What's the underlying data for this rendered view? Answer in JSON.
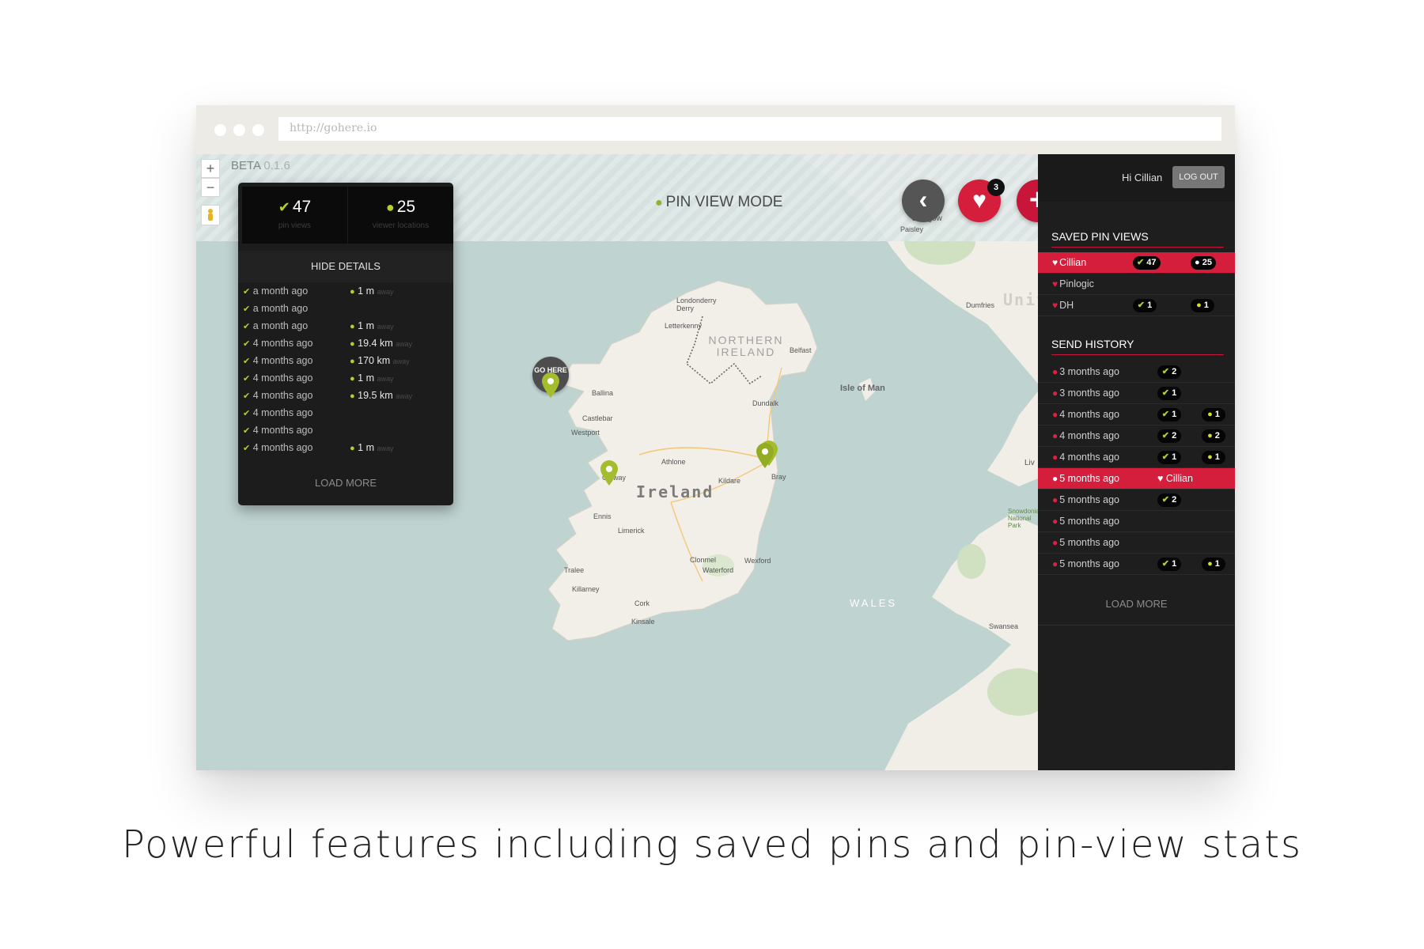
{
  "browser": {
    "url": "http://gohere.io"
  },
  "app": {
    "beta_label": "BETA",
    "beta_version": "0.1.6",
    "mode_label": "PIN VIEW MODE"
  },
  "toolbar": {
    "zoom_in": "+",
    "zoom_out": "−",
    "back_glyph": "‹",
    "fav_glyph": "♥",
    "add_glyph": "+",
    "fav_count": "3"
  },
  "map": {
    "labels": [
      {
        "text": "Ireland"
      },
      {
        "text": "NORTHERN IRELAND"
      },
      {
        "text": "Isle of Man"
      },
      {
        "text": "WALES"
      },
      {
        "text": "Londonderry Derry"
      },
      {
        "text": "Letterkenny"
      },
      {
        "text": "Belfast"
      },
      {
        "text": "Glasgow"
      },
      {
        "text": "Paisley"
      },
      {
        "text": "Dumfries"
      },
      {
        "text": "Ballina"
      },
      {
        "text": "Castlebar"
      },
      {
        "text": "Westport"
      },
      {
        "text": "Athlone"
      },
      {
        "text": "Galway"
      },
      {
        "text": "Ennis"
      },
      {
        "text": "Limerick"
      },
      {
        "text": "Tralee"
      },
      {
        "text": "Killarney"
      },
      {
        "text": "Cork"
      },
      {
        "text": "Kinsale"
      },
      {
        "text": "Waterford"
      },
      {
        "text": "Wexford"
      },
      {
        "text": "Clonmel"
      },
      {
        "text": "Kildare"
      },
      {
        "text": "Dundalk"
      },
      {
        "text": "Bray"
      },
      {
        "text": "Swansea"
      },
      {
        "text": "United Kingdom"
      },
      {
        "text": "Snowdonia National Park"
      },
      {
        "text": "Liv"
      }
    ],
    "gohere_marker": "GO HERE"
  },
  "stats": {
    "pin_views": "47",
    "pin_views_label": "pin views",
    "viewer_locations": "25",
    "viewer_locations_label": "viewer locations",
    "hide_details": "HIDE DETAILS",
    "rows": [
      {
        "time": "a month ago",
        "dist": "1 m",
        "away": "away"
      },
      {
        "time": "a month ago",
        "dist": "",
        "away": ""
      },
      {
        "time": "a month ago",
        "dist": "1 m",
        "away": "away"
      },
      {
        "time": "4 months ago",
        "dist": "19.4 km",
        "away": "away"
      },
      {
        "time": "4 months ago",
        "dist": "170 km",
        "away": "away"
      },
      {
        "time": "4 months ago",
        "dist": "1 m",
        "away": "away"
      },
      {
        "time": "4 months ago",
        "dist": "19.5 km",
        "away": "away"
      },
      {
        "time": "4 months ago",
        "dist": "",
        "away": ""
      },
      {
        "time": "4 months ago",
        "dist": "",
        "away": ""
      },
      {
        "time": "4 months ago",
        "dist": "1 m",
        "away": "away"
      }
    ],
    "load_more": "LOAD MORE"
  },
  "sidebar": {
    "greeting": "Hi Cillian",
    "logout": "LOG OUT",
    "saved_title": "SAVED PIN VIEWS",
    "saved": [
      {
        "name": "Cillian",
        "views": "47",
        "locs": "25",
        "active": true
      },
      {
        "name": "Pinlogic",
        "views": "",
        "locs": "",
        "active": false
      },
      {
        "name": "DH",
        "views": "1",
        "locs": "1",
        "active": false
      }
    ],
    "history_title": "SEND HISTORY",
    "history": [
      {
        "time": "3 months ago",
        "views": "2",
        "locs": "",
        "fav": "",
        "active": false
      },
      {
        "time": "3 months ago",
        "views": "1",
        "locs": "",
        "fav": "",
        "active": false
      },
      {
        "time": "4 months ago",
        "views": "1",
        "locs": "1",
        "fav": "",
        "active": false
      },
      {
        "time": "4 months ago",
        "views": "2",
        "locs": "2",
        "fav": "",
        "active": false
      },
      {
        "time": "4 months ago",
        "views": "1",
        "locs": "1",
        "fav": "",
        "active": false
      },
      {
        "time": "5 months ago",
        "views": "",
        "locs": "",
        "fav": "Cillian",
        "active": true
      },
      {
        "time": "5 months ago",
        "views": "2",
        "locs": "",
        "fav": "",
        "active": false
      },
      {
        "time": "5 months ago",
        "views": "",
        "locs": "",
        "fav": "",
        "active": false
      },
      {
        "time": "5 months ago",
        "views": "",
        "locs": "",
        "fav": "",
        "active": false
      },
      {
        "time": "5 months ago",
        "views": "1",
        "locs": "1",
        "fav": "",
        "active": false
      }
    ],
    "load_more": "LOAD MORE"
  },
  "colors": {
    "accent_red": "#d41e3c",
    "accent_green": "#b6cf2c",
    "panel_dark": "#1a1a1a",
    "sea": "#bfd3d1",
    "land": "#f2efe9"
  },
  "caption": "Powerful features including saved pins and pin-view stats"
}
